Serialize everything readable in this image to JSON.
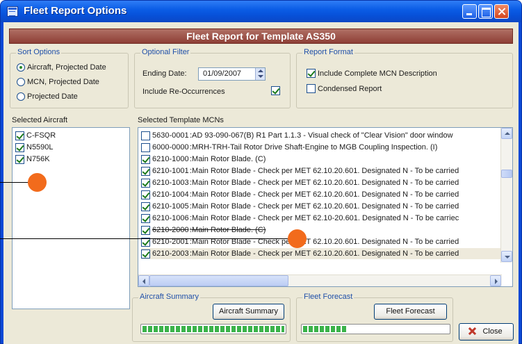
{
  "window": {
    "title": "Fleet Report Options",
    "banner": "Fleet Report for Template AS350"
  },
  "sort_options": {
    "label": "Sort Options",
    "options": [
      {
        "label": "Aircraft, Projected Date",
        "selected": true
      },
      {
        "label": "MCN, Projected Date",
        "selected": false
      },
      {
        "label": "Projected Date",
        "selected": false
      }
    ]
  },
  "optional_filter": {
    "label": "Optional Filter",
    "ending_date_label": "Ending Date:",
    "ending_date_value": "01/09/2007",
    "reoccur_label": "Include Re-Occurrences",
    "reoccur_checked": true
  },
  "report_format": {
    "label": "Report Format",
    "include_complete_label": "Include Complete MCN Description",
    "include_complete_checked": true,
    "condensed_label": "Condensed Report",
    "condensed_checked": false
  },
  "selected_aircraft": {
    "label": "Selected Aircraft",
    "items": [
      {
        "tail": "C-FSQR",
        "checked": true
      },
      {
        "tail": "N5590L",
        "checked": true
      },
      {
        "tail": "N756K",
        "checked": true
      }
    ]
  },
  "selected_mcns": {
    "label": "Selected Template MCNs",
    "rows": [
      {
        "code": "5630-0001",
        "desc": ":AD 93-090-067(B) R1 Part 1.1.3 - Visual check of \"Clear Vision\" door window",
        "checked": false
      },
      {
        "code": "6000-0000",
        "desc": ":MRH-TRH-Tail Rotor Drive Shaft-Engine to MGB Coupling Inspection. (I)",
        "checked": false
      },
      {
        "code": "6210-1000",
        "desc": ":Main Rotor Blade. (C)",
        "checked": true
      },
      {
        "code": "6210-1001",
        "desc": ":Main Rotor Blade - Check per MET 62.10.20.601. Designated N - To be carried",
        "checked": true
      },
      {
        "code": "6210-1003",
        "desc": ":Main Rotor Blade - Check per MET 62.10.20.601. Designated N - To be carried",
        "checked": true
      },
      {
        "code": "6210-1004",
        "desc": ":Main Rotor Blade - Check per MET 62.10.20.601. Designated N - To be carried",
        "checked": true
      },
      {
        "code": "6210-1005",
        "desc": ":Main Rotor Blade - Check per MET 62.10.20.601. Designated N - To be carried",
        "checked": true
      },
      {
        "code": "6210-1006",
        "desc": ":Main Rotor Blade - Check per MET 62.10-20.601. Designated N - To be carriec",
        "checked": true
      },
      {
        "code": "6210-2000",
        "desc": ":Main Rotor Blade. (C)",
        "checked": true
      },
      {
        "code": "6210-2001",
        "desc": ":Main Rotor Blade - Check per MET 62.10.20.601. Designated N - To be carried",
        "checked": true
      },
      {
        "code": "6210-2003",
        "desc": ":Main Rotor Blade - Check per MET 62.10.20.601. Designated N - To be carried",
        "checked": true
      }
    ]
  },
  "aircraft_summary": {
    "label": "Aircraft Summary",
    "button_label": "Aircraft Summary",
    "progress": 1.0
  },
  "fleet_forecast": {
    "label": "Fleet Forecast",
    "button_label": "Fleet Forecast",
    "progress": 0.3
  },
  "close_label": "Close",
  "icons": {
    "title": "report-window-icon",
    "minimize": "minimize-icon",
    "maximize": "maximize-icon",
    "close": "close-icon",
    "close_button": "red-x-icon"
  },
  "colors": {
    "title_bar": "#0b5de6",
    "banner": "#9a4a40",
    "callout_marker": "#f26b1c",
    "progress_fill": "#3bb34a"
  }
}
